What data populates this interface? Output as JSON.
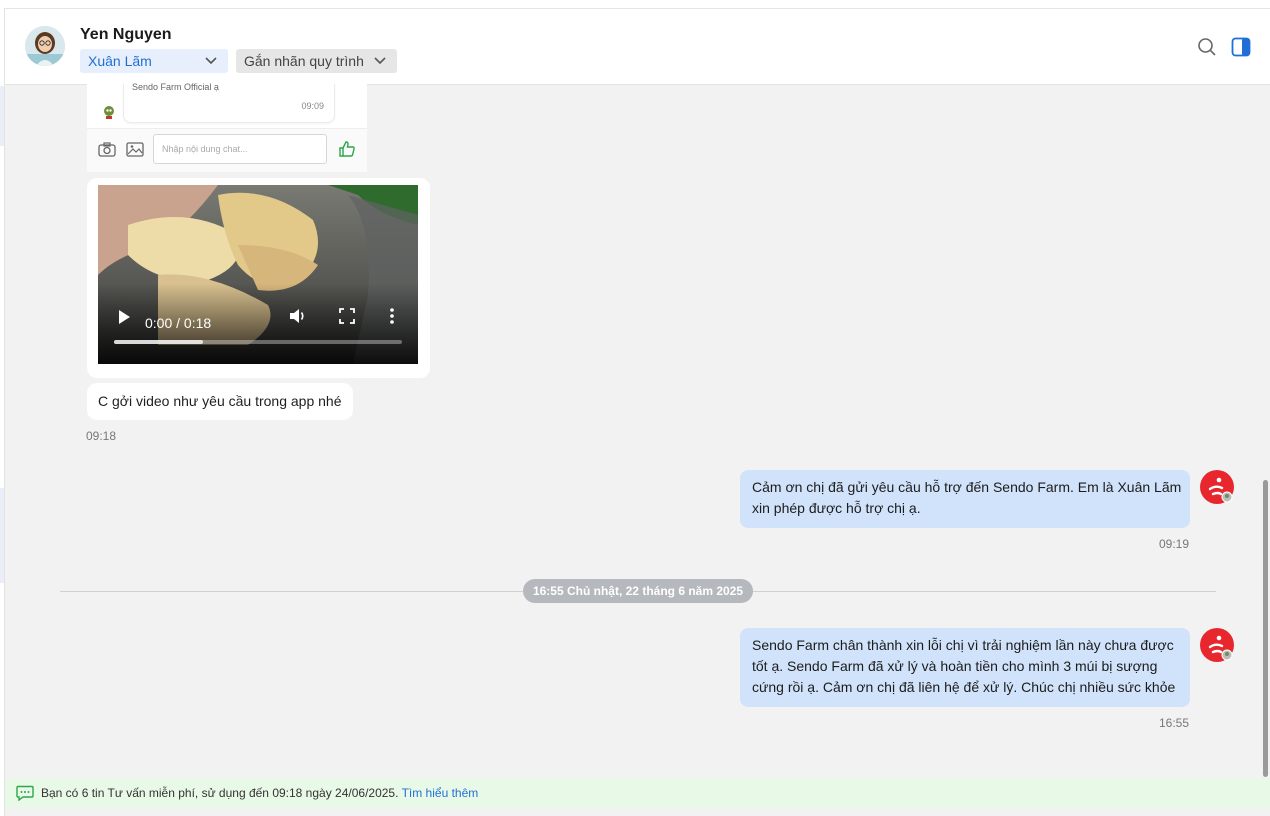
{
  "header": {
    "contact_name": "Yen Nguyen",
    "assignee_dropdown": "Xuân Lãm",
    "tag_dropdown": "Gắn nhãn quy trình",
    "icons": [
      "search-icon",
      "panel-toggle-icon"
    ]
  },
  "embedded_screenshot": {
    "bubble_text": "Sendo Farm Official ạ",
    "bubble_time": "09:09",
    "input_placeholder": "Nhập nội dung chat..."
  },
  "video": {
    "time_display": "0:00 / 0:18",
    "buffered_fraction": 0.31
  },
  "messages": {
    "incoming": {
      "text": "C gởi video như yêu cầu trong app nhé",
      "time": "09:18"
    },
    "outgoing_1": {
      "lines": [
        "Cảm ơn chị đã gửi yêu cầu hỗ trợ đến Sendo Farm. Em là Xuân Lãm",
        "xin phép được hỗ trợ chị ạ."
      ],
      "time": "09:19"
    },
    "date_separator": "16:55 Chủ nhật, 22 tháng 6 năm 2025",
    "outgoing_2": {
      "lines": [
        "Sendo Farm chân thành xin lỗi chị vì trải nghiệm lần này chưa được",
        "tốt ạ. Sendo Farm đã xử lý và hoàn tiền cho mình 3 múi bị sượng",
        "cứng rồi ạ. Cảm ơn chị đã liên hệ để xử lý. Chúc chị nhiều sức khỏe"
      ],
      "time": "16:55"
    }
  },
  "footer": {
    "notice": "Bạn có 6 tin Tư vấn miễn phí, sử dụng đến 09:18 ngày 24/06/2025.",
    "link": "Tìm hiểu thêm"
  },
  "colors": {
    "accent_blue": "#1f6fd6",
    "outgoing_bubble": "#d1e3fb",
    "sendo_red": "#e8262d",
    "footer_bg": "#e9f9e8"
  }
}
